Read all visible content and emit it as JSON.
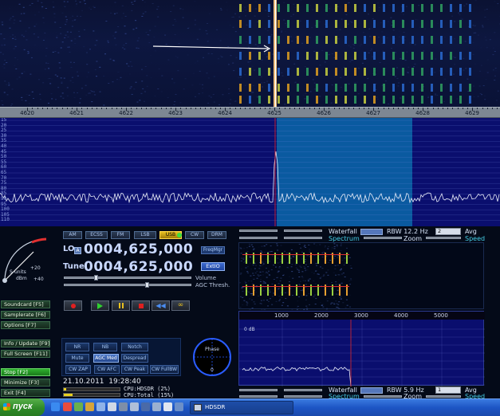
{
  "waterfall": {
    "frequency_labels": [
      "4620",
      "4621",
      "4622",
      "4623",
      "4624",
      "4625",
      "4626",
      "4627",
      "4628",
      "4629"
    ]
  },
  "spectrum": {
    "db_labels": [
      "15",
      "20",
      "25",
      "30",
      "35",
      "40",
      "45",
      "50",
      "55",
      "60",
      "65",
      "70",
      "75",
      "80",
      "85",
      "90",
      "95",
      "100",
      "105",
      "110"
    ]
  },
  "top_controls": {
    "waterfall_label": "Waterfall",
    "spectrum_label": "Spectrum",
    "zoom_label": "Zoom",
    "rbw_label": "RBW 12.2 Hz",
    "avg_label": "Avg",
    "speed_label": "Speed",
    "avg_value": "2"
  },
  "bottom_controls": {
    "waterfall_label": "Waterfall",
    "spectrum_label": "Spectrum",
    "zoom_label": "Zoom",
    "rbw_label": "RBW 5.9 Hz",
    "avg_label": "Avg",
    "speed_label": "Speed",
    "avg_value": "1"
  },
  "modes": [
    "AM",
    "ECSS",
    "FM",
    "LSB",
    "USB",
    "CW",
    "DRM"
  ],
  "active_mode": "USB",
  "lo": {
    "label": "LO",
    "tag": "A",
    "value": "0004,625,000"
  },
  "tune": {
    "label": "Tune",
    "value": "0004,625,000"
  },
  "freqmgr_label": "FreqMgr",
  "extio_label": "ExtIO",
  "volume_label": "Volume",
  "agc_thresh_label": "AGC Thresh.",
  "smeter": {
    "units_label": "S-units",
    "dbm_label": "dBm",
    "plus20": "+20",
    "plus40": "+40"
  },
  "sidebar": {
    "soundcard": "Soundcard [F5]",
    "samplerate": "Samplerate [F6]",
    "options": "Options [F7]",
    "info_update": "Info / Update [F9]",
    "full_screen": "Full Screen [F11]",
    "stop": "Stop [F2]",
    "minimize": "Minimize [F3]",
    "exit": "Exit [F4]"
  },
  "dsp": {
    "nr": "NR",
    "nb": "NB",
    "notch": "Notch",
    "mute": "Mute",
    "agc_med": "AGC Med",
    "despread": "Despread",
    "cw_zap": "CW ZAP",
    "cw_afc": "CW AFC",
    "cw_peak": "CW Peak",
    "cw_fullbw": "CW FullBW"
  },
  "datetime": "21.10.2011  19:28:40",
  "cpu_hdsdr": "CPU:HDSDR (2%)",
  "cpu_total": "CPU:Total (15%)",
  "phase": {
    "label": "Phase",
    "value": "0"
  },
  "af_spectrum": {
    "freq_labels": [
      "1000",
      "2000",
      "3000",
      "4000",
      "5000"
    ],
    "db_label": "0 dB"
  },
  "taskbar": {
    "start_label": "пуск",
    "task_label": "HDSDR"
  },
  "colors": {
    "waterfall_bg": "#0b1233",
    "spectrum_bg": "#0a0e6e",
    "passband": "#0a5aa0",
    "active_green": "#2fb12f",
    "mode_active": "#e8c020"
  }
}
